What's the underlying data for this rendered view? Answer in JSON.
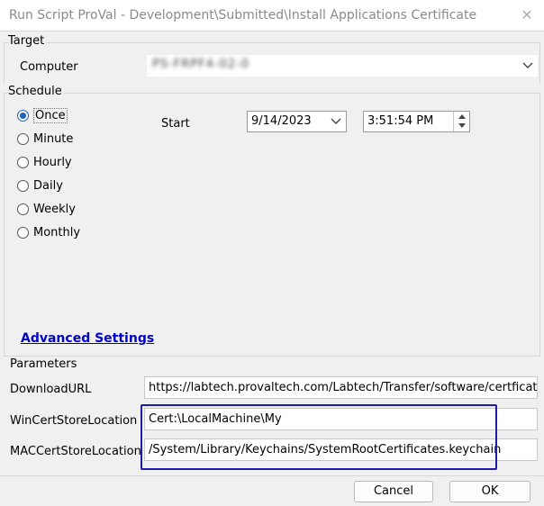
{
  "window": {
    "title": "Run Script ProVal - Development\\Submitted\\Install Applications Certificate"
  },
  "target": {
    "group_label": "Target",
    "computer_label": "Computer",
    "computer_value": "PS-FRPF4-02-0"
  },
  "schedule": {
    "group_label": "Schedule",
    "options": [
      "Once",
      "Minute",
      "Hourly",
      "Daily",
      "Weekly",
      "Monthly"
    ],
    "selected": "Once",
    "start_label": "Start",
    "start_date": "9/14/2023",
    "start_time": "3:51:54 PM"
  },
  "advanced_settings_label": "Advanced Settings",
  "parameters": {
    "group_label": "Parameters",
    "rows": [
      {
        "label": "DownloadURL",
        "value": "https://labtech.provaltech.com/Labtech/Transfer/software/certficates/"
      },
      {
        "label": "WinCertStoreLocation",
        "value": "Cert:\\LocalMachine\\My"
      },
      {
        "label": "MACCertStoreLocation",
        "value": "/System/Library/Keychains/SystemRootCertificates.keychain"
      }
    ]
  },
  "buttons": {
    "cancel": "Cancel",
    "ok": "OK"
  },
  "colors": {
    "link": "#0000cc",
    "highlight_box": "#1c1ca8",
    "radio_selected": "#1f5fbf"
  },
  "icons": [
    "close-icon",
    "chevron-down-icon",
    "spin-up-icon",
    "spin-down-icon"
  ]
}
